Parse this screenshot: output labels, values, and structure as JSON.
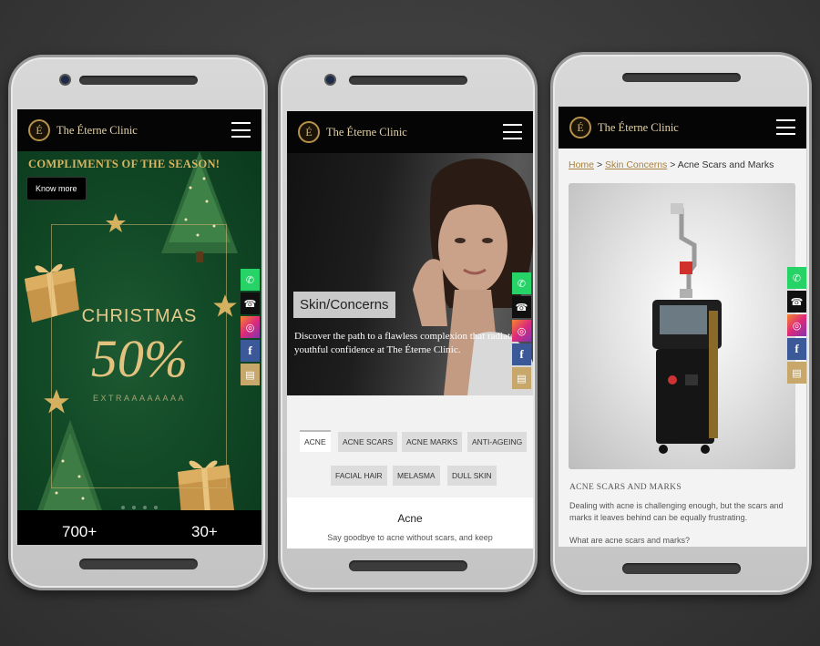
{
  "brand": {
    "name": "The Éterne Clinic",
    "monogram": "É"
  },
  "colors": {
    "gold": "#c8a86a",
    "header": "#050505",
    "link": "#a8823e"
  },
  "social": [
    "whatsapp-icon",
    "phone-icon",
    "instagram-icon",
    "facebook-icon",
    "contact-card-icon"
  ],
  "phone1": {
    "banner_heading": "COMPLIMENTS OF THE SEASON!",
    "cta_label": "Know more",
    "promo_title": "CHRISTMAS",
    "promo_value": "50%",
    "promo_sub": "EXTRAAAAAAAA",
    "stats": [
      "700+",
      "30+"
    ]
  },
  "phone2": {
    "hero_title": "Skin/Concerns",
    "hero_desc": "Discover the path to a flawless complexion that radiates youthful confidence at The Éterne Clinic.",
    "tabs": [
      "ACNE",
      "ACNE SCARS",
      "ACNE MARKS",
      "ANTI-AGEING",
      "FACIAL HAIR",
      "MELASMA",
      "DULL SKIN"
    ],
    "section_title": "Acne",
    "section_desc": "Say goodbye to acne without scars, and keep"
  },
  "phone3": {
    "breadcrumb": {
      "home": "Home",
      "sep": ">",
      "parent": "Skin Concerns",
      "current": "Acne Scars and Marks"
    },
    "title": "ACNE SCARS AND MARKS",
    "desc": "Dealing with acne is challenging enough, but the scars and marks it leaves behind can be equally frustrating.",
    "cut_text": "What are acne scars and marks?"
  }
}
